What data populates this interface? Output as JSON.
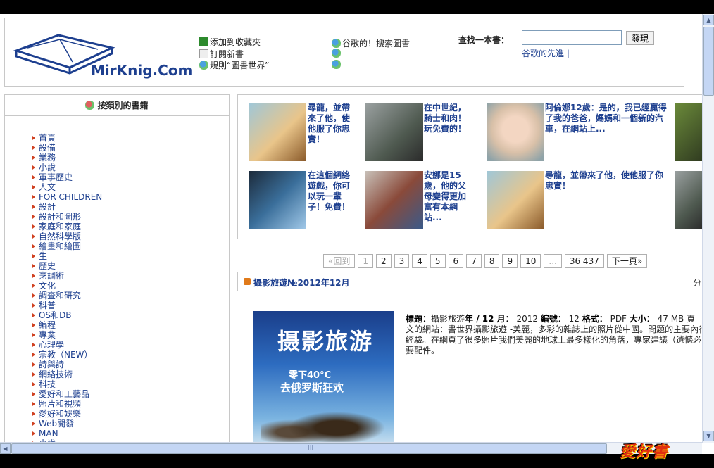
{
  "header": {
    "logo_text": "MirKnig.Com",
    "links_col1": [
      {
        "label": "添加到收藏夾",
        "icon": "bookmark-icon"
      },
      {
        "label": "訂閱新書",
        "icon": "mail-icon"
      },
      {
        "label": "規則“圖書世界”",
        "icon": "users-icon"
      }
    ],
    "links_col2": [
      {
        "label": "谷歌的！搜索圖書",
        "icon": "users-icon"
      },
      {
        "label": "",
        "icon": "users-icon"
      },
      {
        "label": "",
        "icon": "users-icon"
      }
    ],
    "search": {
      "label": "查找一本書：",
      "value": "",
      "button": "發現",
      "sub": "谷歌的先進 |"
    }
  },
  "sidebar": {
    "title": "按類別的書籍",
    "items": [
      "首頁",
      "設備",
      "業務",
      "小說",
      "軍事歷史",
      "人文",
      "FOR CHILDREN",
      "設計",
      "設計和圖形",
      "家庭和家庭",
      "自然科學版",
      "繪畫和繪圖",
      "生",
      "歷史",
      "烹調術",
      "文化",
      "調查和研究",
      "科普",
      "OS和DB",
      "編程",
      "專業",
      "心理學",
      "宗教（NEW）",
      "詩與詩",
      "網絡技術",
      "科技",
      "愛好和工藝品",
      "照片和視頻",
      "愛好和娛樂",
      "Web開發",
      "MAN",
      "小說"
    ]
  },
  "thumbs": [
    {
      "caption": "尋龍，並帶來了他，使他服了你忠實！",
      "img": "dragon"
    },
    {
      "caption": "在中世紀，騎士和肉！玩免費的！",
      "img": "knight"
    },
    {
      "caption": "阿倫娜12歲：是的，我已經贏得了我的爸爸，媽媽和一個新的汽車，在網站上...",
      "img": "girl"
    },
    {
      "caption": "",
      "img": "warrior"
    },
    {
      "caption": "在這個網絡遊戲，你可以玩一輩子！免費！",
      "img": "fighter"
    },
    {
      "caption": "安娜是15歲，他的父母變得更加富有本網站...",
      "img": "teen"
    },
    {
      "caption": "尋龍，並帶來了他，使他服了你忠實！",
      "img": "dragon"
    },
    {
      "caption": "",
      "img": "knight"
    }
  ],
  "pager": {
    "prev": "«回到",
    "pages": [
      "1",
      "2",
      "3",
      "4",
      "5",
      "6",
      "7",
      "8",
      "9",
      "10",
      "...",
      "36 437"
    ],
    "next": "下一頁»"
  },
  "post": {
    "title": "攝影旅遊№2012年12月",
    "category": "分",
    "cover_title": "摄影旅游",
    "cover_sub1": "零下40°C",
    "cover_sub2": "去俄罗斯狂欢",
    "desc_label1": "標題：",
    "desc_val1": "攝影旅遊",
    "desc_label2": "年 / 12 月：",
    "desc_val2": " 2012 ",
    "desc_label3": "編號：",
    "desc_val3": " 12 ",
    "desc_label4": "格式：",
    "desc_val4": " PDF ",
    "desc_label5": "大小：",
    "desc_val5": " 47 MB 頁",
    "desc_text": "文的網站：書世界攝影旅遊 -美麗，多彩的雜誌上的照片從中國。問題的主要內行經驗。在網頁了很多照片我們美麗的地球上最多樣化的角落，專家建議（遺憾必要配件。"
  },
  "watermark": "愛好書",
  "colors": {
    "link": "#1d3f8f",
    "border": "#c8c8c8",
    "bullet": "#d04020"
  }
}
